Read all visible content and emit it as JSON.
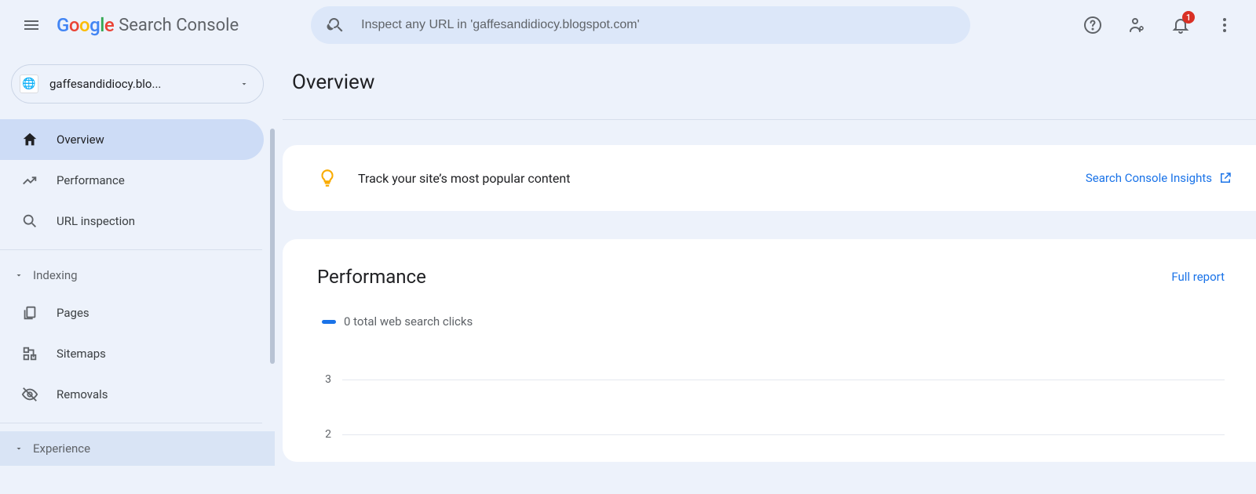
{
  "header": {
    "product_name": "Search Console",
    "search_placeholder": "Inspect any URL in 'gaffesandidiocy.blogspot.com'",
    "notification_count": "1"
  },
  "sidebar": {
    "property_label": "gaffesandidiocy.blo...",
    "items": {
      "overview": "Overview",
      "performance": "Performance",
      "url_inspection": "URL inspection"
    },
    "sections": {
      "indexing": {
        "label": "Indexing",
        "pages": "Pages",
        "sitemaps": "Sitemaps",
        "removals": "Removals"
      },
      "experience": {
        "label": "Experience"
      }
    }
  },
  "main": {
    "title": "Overview",
    "insights_banner": "Track your site’s most popular content",
    "insights_link": "Search Console Insights",
    "performance_title": "Performance",
    "full_report": "Full report",
    "legend": "0 total web search clicks"
  },
  "chart_data": {
    "type": "line",
    "title": "Performance",
    "ylabel": "",
    "ylim": [
      0,
      3
    ],
    "yticks": [
      3,
      2
    ],
    "series": [
      {
        "name": "total web search clicks",
        "values": [
          0
        ]
      }
    ]
  }
}
